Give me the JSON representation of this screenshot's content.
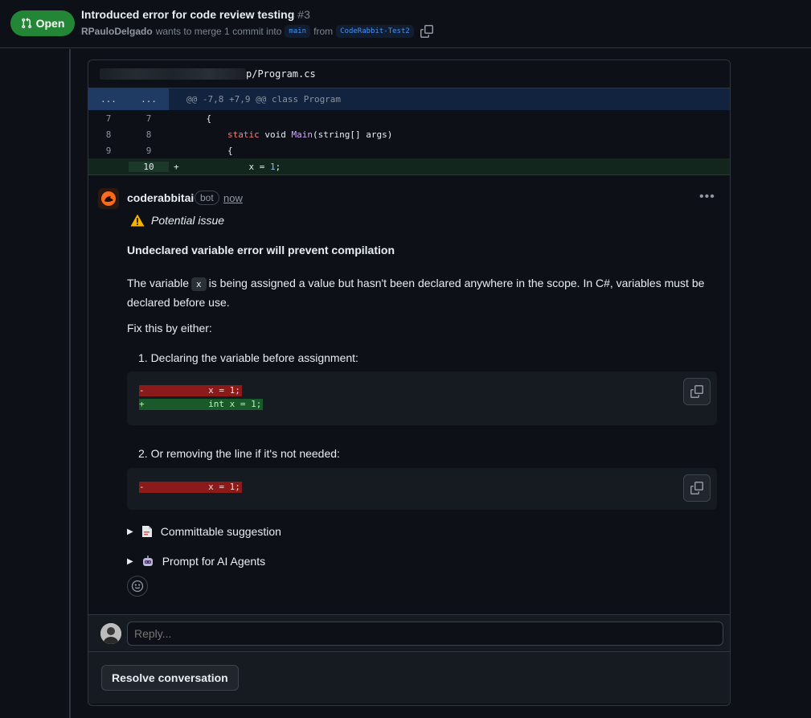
{
  "header": {
    "status": "Open",
    "title": "Introduced error for code review testing",
    "number": "#3",
    "author": "RPauloDelgado",
    "merge_text": "wants to merge 1 commit into",
    "base_branch": "main",
    "from_text": "from",
    "head_branch": "CodeRabbit-Test2"
  },
  "file": {
    "name": "p/Program.cs",
    "hunk_expand_left": "...",
    "hunk_expand_right": "...",
    "hunk_header": "@@ -7,8 +7,9 @@ class Program",
    "lines": [
      {
        "old": "7",
        "new": "7",
        "sign": "",
        "code": "    {"
      },
      {
        "old": "8",
        "new": "8",
        "sign": "",
        "kw": "static",
        "code_a": " void ",
        "fn": "Main",
        "code_b": "(string[] args)"
      },
      {
        "old": "9",
        "new": "9",
        "sign": "",
        "code": "    {"
      },
      {
        "old": "",
        "new": "10",
        "sign": "+",
        "code_pre": "        x = ",
        "num": "1",
        "code_post": ";"
      }
    ]
  },
  "comment": {
    "author": "coderabbitai",
    "bot_tag": "bot",
    "time": "now",
    "issue_label": "Potential issue",
    "heading": "Undeclared variable error will prevent compilation",
    "para_before": "The variable",
    "para_code": "x",
    "para_after": "is being assigned a value but hasn't been declared anywhere in the scope. In C#, variables must be declared before use.",
    "fix_intro": "Fix this by either:",
    "option1": "1. Declaring the variable before assignment:",
    "code1_del": "-            x = 1;",
    "code1_add": "+            int x = 1;",
    "option2": "2. Or removing the line if it's not needed:",
    "code2_del": "-            x = 1;",
    "details1": "Committable suggestion",
    "details2": "Prompt for AI Agents"
  },
  "reply": {
    "placeholder": "Reply..."
  },
  "resolve_label": "Resolve conversation",
  "colors": {
    "open_green": "#238636",
    "bg": "#0d1117",
    "add_bg": "#12261e",
    "del_highlight": "#8b1a1a",
    "add_highlight": "#1a5a2a",
    "link_blue": "#4493f8"
  },
  "icons": {
    "status": "git-pull-request-icon",
    "copy": "copy-icon",
    "warning": "warning-icon",
    "more": "kebab-menu-icon",
    "emoji": "smiley-icon",
    "suggestion": "document-icon",
    "agents": "robot-icon"
  }
}
